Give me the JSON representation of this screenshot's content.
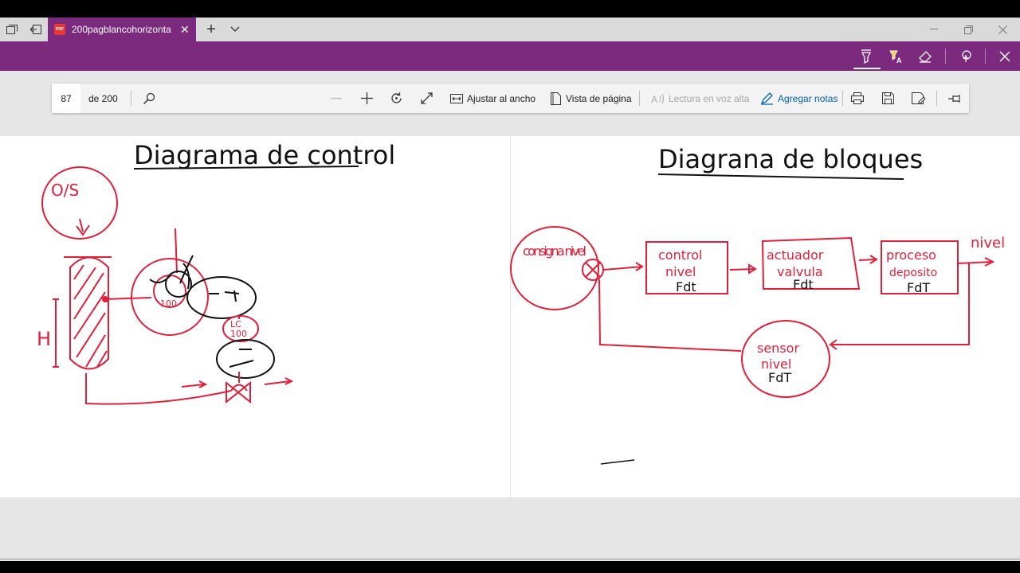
{
  "tabbar": {
    "tab_title": "200pagblancohorizonta",
    "pdf_badge": "PDF",
    "new_tab_glyph": "+",
    "dropdown_glyph": "⌄"
  },
  "reader": {
    "page_number": "87",
    "page_total": "de 200",
    "fit_width_label": "Ajustar al ancho",
    "page_view_label": "Vista de página",
    "read_aloud_label": "Lectura en voz alta",
    "add_notes_label": "Agregar notas"
  },
  "document": {
    "left": {
      "title": "Diagrama de control",
      "height_label": "H",
      "controller_tag": "100",
      "lc_label": "LC",
      "lc_tag": "100",
      "source_label": "O/S"
    },
    "right": {
      "title": "Diagrana de bloques",
      "input_label": "consigna nivel",
      "output_label": "nivel",
      "blocks": [
        {
          "line1": "control",
          "line2": "nivel",
          "line3": "Fdt"
        },
        {
          "line1": "actuador",
          "line2": "valvula",
          "line3": "Fdt"
        },
        {
          "line1": "proceso",
          "line2": "deposito",
          "line3": "FdT"
        }
      ],
      "feedback": {
        "line1": "sensor",
        "line2": "nivel",
        "line3": "FdT"
      }
    }
  },
  "colors": {
    "accent_purple": "#7b2a7e",
    "ink_red": "#e0203a",
    "ink_black": "#111111",
    "link_blue": "#0063b1"
  },
  "icons": [
    "tab-set-aside-icon",
    "tab-back-icon",
    "pdf-icon",
    "close-icon",
    "plus-icon",
    "chevron-down-icon",
    "minimize-icon",
    "restore-icon",
    "highlighter-icon",
    "text-highlight-icon",
    "eraser-icon",
    "touch-write-icon",
    "search-icon",
    "zoom-out-icon",
    "zoom-in-icon",
    "rotate-icon",
    "fullscreen-icon",
    "fit-width-icon",
    "page-view-icon",
    "read-aloud-icon",
    "add-notes-icon",
    "print-icon",
    "save-icon",
    "save-as-icon",
    "pin-icon"
  ]
}
